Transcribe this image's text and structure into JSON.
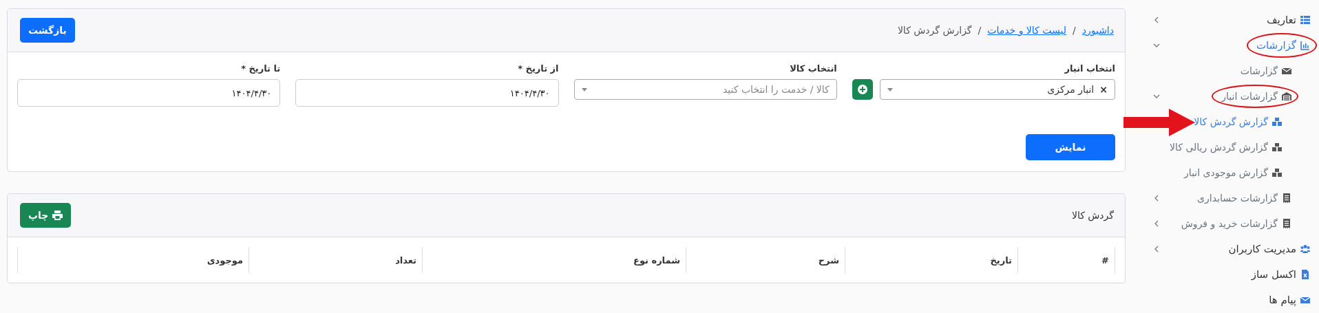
{
  "breadcrumb": [
    {
      "kind": "link",
      "text": "داشبورد"
    },
    {
      "kind": "separator",
      "text": "/"
    },
    {
      "kind": "link",
      "text": "لیست کالا و خدمات"
    },
    {
      "kind": "separator",
      "text": "/"
    },
    {
      "kind": "current",
      "text": "گزارش گردش کالا"
    }
  ],
  "back_button": "بازگشت",
  "filters": [
    {
      "kind": "select",
      "label": "انتخاب انبار",
      "value": "انبار مرکزی",
      "clear": "×"
    },
    {
      "kind": "select",
      "label": "انتخاب کالا",
      "placeholder": "کالا / خدمت را انتخاب کنید"
    },
    {
      "kind": "date",
      "label": "از تاریخ *",
      "value": "۱۴۰۴/۴/۳۰"
    },
    {
      "kind": "date",
      "label": "تا تاریخ *",
      "value": "۱۴۰۴/۴/۳۰"
    }
  ],
  "show_button": "نمایش",
  "report": {
    "title": "گردش کالا",
    "print_button": "چاپ",
    "columns": [
      "#",
      "تاریخ",
      "شرح",
      "شماره نوع",
      "تعداد",
      "موجودی"
    ]
  },
  "sidebar": {
    "items": [
      {
        "label": "تعاریف",
        "selected": false,
        "expanded": false,
        "circled": false,
        "arrow": false
      },
      {
        "label": "گزارشات",
        "selected": true,
        "expanded": true,
        "circled": true,
        "arrow": false,
        "children": [
          {
            "label": "گزارشات",
            "selected": false,
            "circled": false,
            "arrow": false
          },
          {
            "label": "گزارشات انبار",
            "selected": false,
            "expanded": true,
            "circled": true,
            "arrow": false,
            "children": [
              {
                "label": "گزارش گردش کالا",
                "selected": true,
                "circled": false,
                "arrow": true
              },
              {
                "label": "گزارش گردش ریالی کالا",
                "selected": false,
                "circled": false,
                "arrow": false
              },
              {
                "label": "گزارش موجودی انبار",
                "selected": false,
                "circled": false,
                "arrow": false
              }
            ]
          },
          {
            "label": "گزارشات حسابداری",
            "selected": false,
            "expanded": false,
            "circled": false,
            "arrow": false
          },
          {
            "label": "گزارشات خرید و فروش",
            "selected": false,
            "expanded": false,
            "circled": false,
            "arrow": false
          }
        ]
      },
      {
        "label": "مدیریت کاربران",
        "selected": false,
        "expanded": false,
        "circled": false,
        "arrow": false
      },
      {
        "label": "اکسل ساز",
        "selected": false,
        "circled": false,
        "arrow": false
      },
      {
        "label": "پیام ها",
        "selected": false,
        "circled": false,
        "arrow": false
      }
    ]
  }
}
